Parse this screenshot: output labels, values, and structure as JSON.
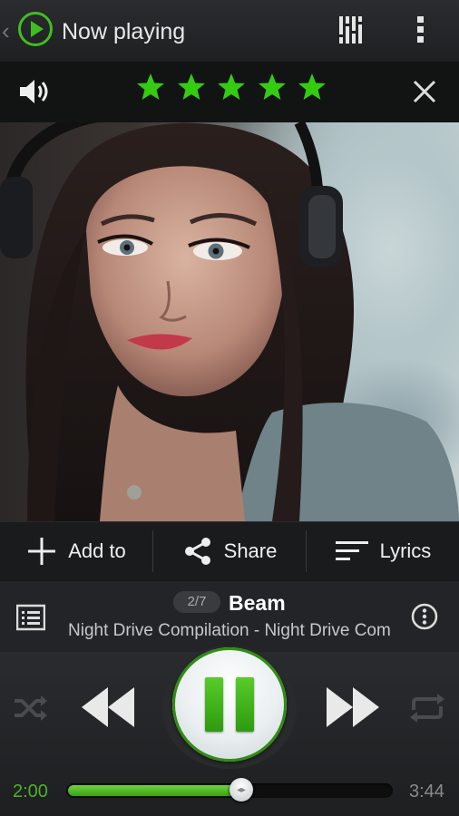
{
  "header": {
    "title": "Now playing"
  },
  "rating": {
    "stars": 5,
    "max": 5,
    "star_color": "#33cc11"
  },
  "actions": [
    {
      "label": "Add to",
      "icon": "plus-icon"
    },
    {
      "label": "Share",
      "icon": "share-icon"
    },
    {
      "label": "Lyrics",
      "icon": "lyrics-icon"
    }
  ],
  "track": {
    "counter": "2/7",
    "title": "Beam",
    "subtitle": "Night Drive Compilation - Night Drive Compilation"
  },
  "playback": {
    "elapsed": "2:00",
    "total": "3:44",
    "progress": 0.536,
    "state": "playing"
  },
  "colors": {
    "accent": "#3fbf1f",
    "background": "#1c1d1f"
  }
}
